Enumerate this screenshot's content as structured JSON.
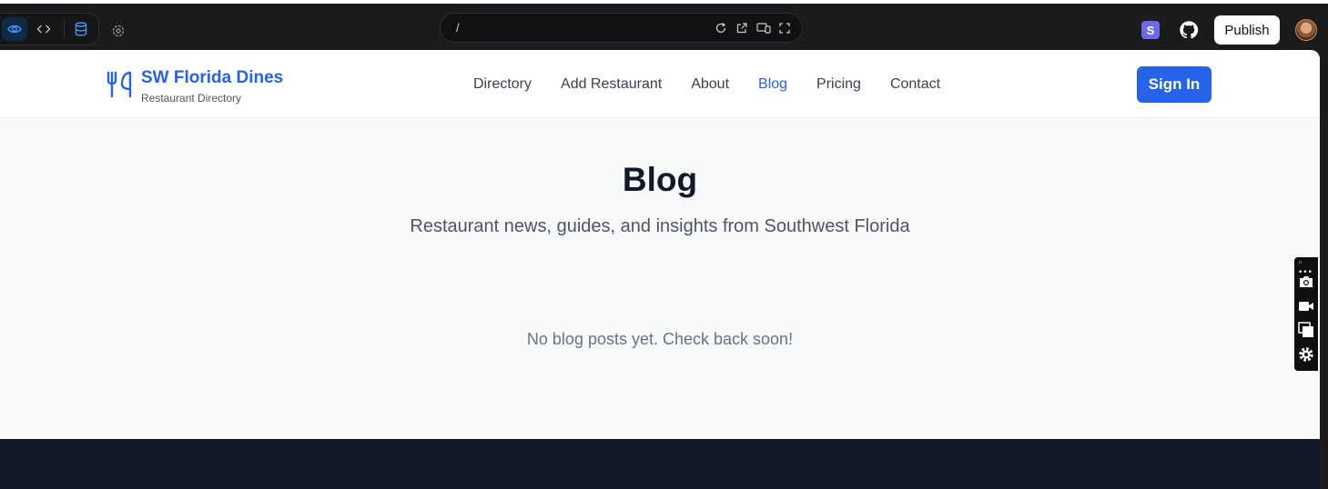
{
  "editor": {
    "url_path": "/",
    "publish_label": "Publish",
    "badge_letter": "S",
    "icons": [
      "eye-icon",
      "code-icon",
      "database-icon",
      "settings-icon",
      "reload-icon",
      "external-link-icon",
      "devices-icon",
      "fullscreen-icon",
      "github-icon"
    ]
  },
  "site": {
    "brand": "SW Florida Dines",
    "tagline": "Restaurant Directory",
    "nav": [
      "Directory",
      "Add Restaurant",
      "About",
      "Blog",
      "Pricing",
      "Contact"
    ],
    "active_nav": "Blog",
    "signin_label": "Sign In"
  },
  "page": {
    "title": "Blog",
    "subtitle": "Restaurant news, guides, and insights from Southwest Florida",
    "empty_message": "No blog posts yet. Check back soon!"
  },
  "floating_toolbar": {
    "dots": "◦ •••",
    "icons": [
      "camera-icon",
      "video-icon",
      "copy-icon",
      "gear-icon"
    ]
  },
  "colors": {
    "brand_blue": "#2563eb",
    "footer": "#111827",
    "page_bg": "#f8fafc",
    "editor_bg": "#1b1b1d"
  }
}
